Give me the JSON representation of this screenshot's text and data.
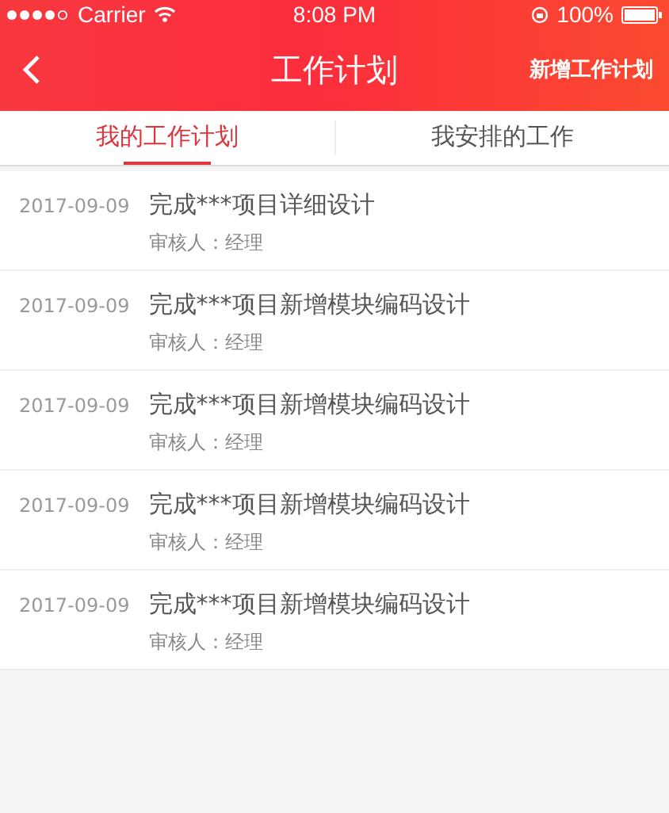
{
  "status_bar": {
    "carrier": "Carrier",
    "time": "8:08 PM",
    "battery": "100%"
  },
  "nav": {
    "title": "工作计划",
    "action": "新增工作计划"
  },
  "tabs": [
    {
      "label": "我的工作计划",
      "selected": true
    },
    {
      "label": "我安排的工作",
      "selected": false
    }
  ],
  "plans": [
    {
      "date": "2017-09-09",
      "title": "完成***项目详细设计",
      "reviewer": "审核人：经理"
    },
    {
      "date": "2017-09-09",
      "title": "完成***项目新增模块编码设计",
      "reviewer": "审核人：经理"
    },
    {
      "date": "2017-09-09",
      "title": "完成***项目新增模块编码设计",
      "reviewer": "审核人：经理"
    },
    {
      "date": "2017-09-09",
      "title": "完成***项目新增模块编码设计",
      "reviewer": "审核人：经理"
    },
    {
      "date": "2017-09-09",
      "title": "完成***项目新增模块编码设计",
      "reviewer": "审核人：经理"
    }
  ]
}
